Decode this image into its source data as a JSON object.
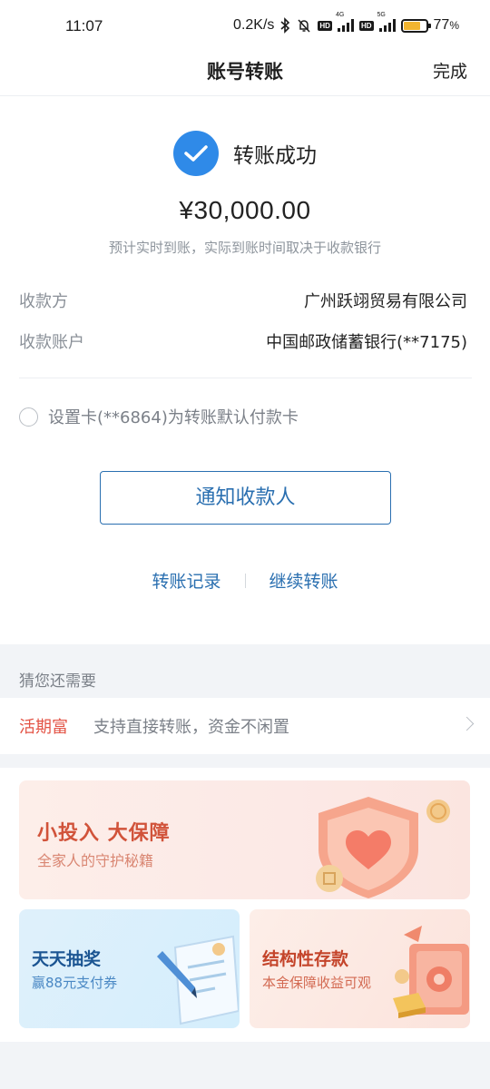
{
  "status_bar": {
    "time": "11:07",
    "net_speed": "0.2K/s",
    "hd1": "HD",
    "net1": "4G",
    "hd2": "HD",
    "net2": "5G",
    "battery_text": "77",
    "battery_unit": "%",
    "battery_level": 0.77,
    "battery_color": "#f2b530"
  },
  "header": {
    "title": "账号转账",
    "done_label": "完成"
  },
  "result": {
    "status_text": "转账成功",
    "amount": "¥30,000.00",
    "arrival_note": "预计实时到账，实际到账时间取决于收款银行"
  },
  "details": [
    {
      "label": "收款方",
      "value": "广州跃翊贸易有限公司"
    },
    {
      "label": "收款账户",
      "value": "中国邮政储蓄银行(**7175)"
    }
  ],
  "default_card_label": "设置卡(**6864)为转账默认付款卡",
  "notify_button": "通知收款人",
  "links": {
    "history": "转账记录",
    "continue": "继续转账"
  },
  "suggest": {
    "heading": "猜您还需要",
    "product_name": "活期富",
    "product_desc": "支持直接转账，资金不闲置"
  },
  "promos": {
    "big": {
      "title": "小投入  大保障",
      "subtitle": "全家人的守护秘籍"
    },
    "left": {
      "title": "天天抽奖",
      "subtitle": "赢88元支付券"
    },
    "right": {
      "title": "结构性存款",
      "subtitle": "本金保障收益可观"
    }
  },
  "colors": {
    "accent_blue": "#2f8ae8",
    "link_blue": "#2a6fb0",
    "product_red": "#e35345"
  }
}
